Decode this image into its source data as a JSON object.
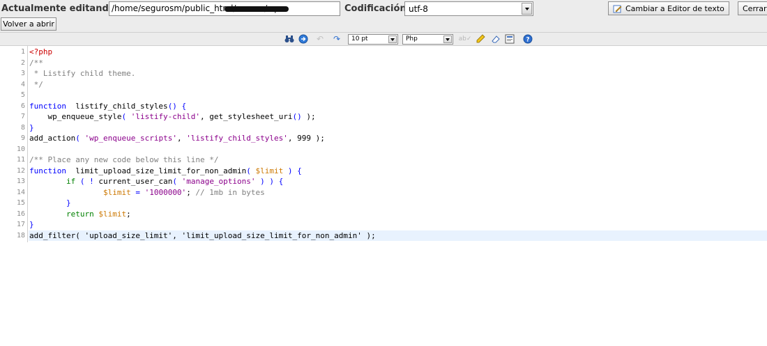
{
  "header": {
    "editing_label": "Actualmente editando:",
    "path_value": "/home/segurosm/public_html/u                        .com/wp-",
    "encoding_label": "Codificación:",
    "encoding_value": "utf-8",
    "text_editor_button": "Cambiar a Editor de texto",
    "close_button": "Cerrar",
    "reopen_button": "Volver a abrir"
  },
  "toolbar": {
    "font_size": "10 pt",
    "language": "Php",
    "icons": [
      "binoculars-icon",
      "goto-icon",
      "undo-icon",
      "redo-icon",
      "spellcheck-icon",
      "highlight-icon",
      "eraser-icon",
      "fullscreen-icon",
      "help-icon"
    ]
  },
  "code": {
    "active_line": 18,
    "lines": [
      [
        [
          "t-tag",
          "<?php"
        ]
      ],
      [
        [
          "t-cmt",
          "/**"
        ]
      ],
      [
        [
          "t-cmt",
          " * Listify child theme."
        ]
      ],
      [
        [
          "t-cmt",
          " */"
        ]
      ],
      [],
      [
        [
          "t-kw",
          "function"
        ],
        [
          "",
          "  listify_child_styles"
        ],
        [
          "t-kw",
          "() {"
        ]
      ],
      [
        [
          "",
          "    wp_enqueue_style"
        ],
        [
          "t-kw",
          "( "
        ],
        [
          "t-str",
          "'listify-child'"
        ],
        [
          "",
          ", get_stylesheet_uri"
        ],
        [
          "t-kw",
          "()"
        ],
        [
          "",
          " );"
        ]
      ],
      [
        [
          "t-kw",
          "}"
        ]
      ],
      [
        [
          "",
          "add_action"
        ],
        [
          "t-kw",
          "( "
        ],
        [
          "t-str",
          "'wp_enqueue_scripts'"
        ],
        [
          "",
          ", "
        ],
        [
          "t-str",
          "'listify_child_styles'"
        ],
        [
          "",
          ", 999 );"
        ]
      ],
      [],
      [
        [
          "t-cmt",
          "/** Place any new code below this line */"
        ]
      ],
      [
        [
          "t-kw",
          "function"
        ],
        [
          "",
          "  limit_upload_size_limit_for_non_admin"
        ],
        [
          "t-kw",
          "( "
        ],
        [
          "t-var",
          "$limit"
        ],
        [
          "t-kw",
          " ) {"
        ]
      ],
      [
        [
          "t-key",
          "        if"
        ],
        [
          "t-kw",
          " ( ! "
        ],
        [
          "",
          "current_user_can"
        ],
        [
          "t-kw",
          "( "
        ],
        [
          "t-str",
          "'manage_options'"
        ],
        [
          "t-kw",
          " ) ) {"
        ]
      ],
      [
        [
          "t-var",
          "                $limit"
        ],
        [
          "t-kw",
          " = "
        ],
        [
          "t-str",
          "'1000000'"
        ],
        [
          "",
          ";"
        ],
        [
          "t-cmt",
          " // 1mb in bytes"
        ]
      ],
      [
        [
          "t-kw",
          "        }"
        ]
      ],
      [
        [
          "t-key",
          "        return"
        ],
        [
          "t-var",
          " $limit"
        ],
        [
          "",
          ";"
        ]
      ],
      [
        [
          "t-kw",
          "}"
        ]
      ],
      [
        [
          "",
          "add_filter( 'upload_size_limit', 'limit_upload_size_limit_for_non_admin' );"
        ]
      ]
    ]
  }
}
